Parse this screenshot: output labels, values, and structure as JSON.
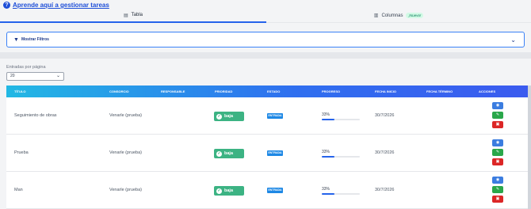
{
  "help": {
    "icon": "question-circle-icon",
    "label": "Aprende aquí a gestionar tareas"
  },
  "tabs": [
    {
      "label": "Tabla",
      "icon": "table-icon",
      "active": true
    },
    {
      "label": "Columnas",
      "icon": "columns-icon",
      "badge": "¡Nuevo!",
      "active": false
    }
  ],
  "filters": {
    "label": "Mostrar Filtros",
    "icon": "filter-icon"
  },
  "entries": {
    "label": "Entradas por página",
    "value": "20"
  },
  "table": {
    "headers": [
      "Título",
      "Consorcio",
      "Responsable",
      "Prioridad",
      "Estado",
      "Progreso",
      "Fecha inicio",
      "Fecha término",
      "Acciones"
    ],
    "rows": [
      {
        "title": "Seguimiento de obras",
        "consorcio": "Venarle (prueba)",
        "responsable": "",
        "prioridad": "baja",
        "estado": "ENTRADA",
        "progreso_label": "33%",
        "progreso": 0.33,
        "fecha_inicio": "30/7/2026",
        "fecha_termino": ""
      },
      {
        "title": "Prueba",
        "consorcio": "Venarle (prueba)",
        "responsable": "",
        "prioridad": "baja",
        "estado": "ENTRADA",
        "progreso_label": "33%",
        "progreso": 0.33,
        "fecha_inicio": "30/7/2026",
        "fecha_termino": ""
      },
      {
        "title": "Man",
        "consorcio": "Venarle (prueba)",
        "responsable": "",
        "prioridad": "baja",
        "estado": "ENTRADA",
        "progreso_label": "33%",
        "progreso": 0.33,
        "fecha_inicio": "30/7/2026",
        "fecha_termino": ""
      }
    ]
  },
  "colors": {
    "accent": "#2563eb",
    "priority_low": "#3cb383",
    "state_entry": "#1e88e5",
    "view": "#3b7de0",
    "edit": "#2aa74a",
    "delete": "#dc2626"
  }
}
